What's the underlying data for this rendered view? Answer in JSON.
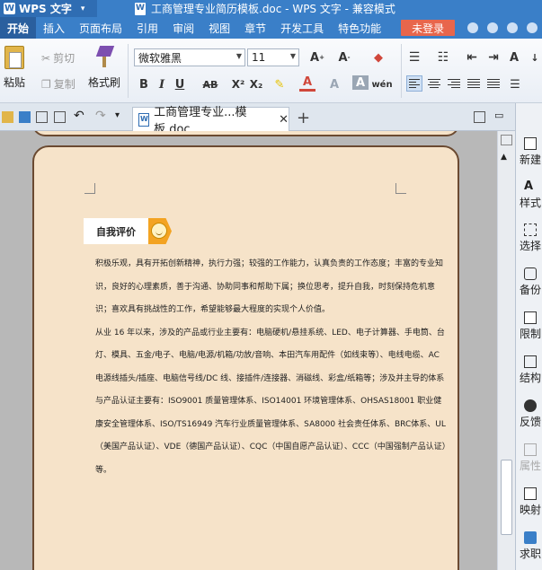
{
  "titlebar": {
    "app_name": "WPS 文字",
    "doc_title": "工商管理专业简历模板.doc - WPS 文字 - 兼容模式"
  },
  "menubar": {
    "items": [
      "开始",
      "插入",
      "页面布局",
      "引用",
      "审阅",
      "视图",
      "章节",
      "开发工具",
      "特色功能"
    ],
    "login_label": "未登录"
  },
  "ribbon": {
    "paste_label": "粘贴",
    "cut_label": "剪切",
    "copy_label": "复制",
    "format_painter_label": "格式刷",
    "font_name": "微软雅黑",
    "font_size": "11"
  },
  "tabbar": {
    "tab_label": "工商管理专业...模板.doc"
  },
  "document": {
    "section_title": "自我评价",
    "paragraphs": [
      "积极乐观，具有开拓创新精神，执行力强；较强的工作能力，认真负责的工作态度；丰富的专业知识，良好的心理素质，善于沟通、协助同事和帮助下属；换位思考，提升自我，时刻保持危机意识；喜欢具有挑战性的工作，希望能够最大程度的实现个人价值。",
      "从业 16 年以来，涉及的产品或行业主要有：电脑硬机/悬挂系统、LED、电子计算器、手电筒、台灯、模具、五金/电子、电脑/电源/机箱/功放/音响、本田汽车用配件（如线束等）、电线电缆、AC 电源线插头/插座、电脑信号线/DC 线、接插件/连接器、消磁线、彩盒/纸箱等；涉及并主导的体系与产品认证主要有：ISO9001 质量管理体系、ISO14001 环境管理体系、OHSAS18001 职业健康安全管理体系、ISO/TS16949 汽车行业质量管理体系、SA8000 社会责任体系、BRC体系、UL（美国产品认证）、VDE（德国产品认证）、CQC（中国自愿产品认证）、CCC（中国强制产品认证）等。"
    ]
  },
  "taskpane": {
    "items": [
      "新建",
      "样式",
      "选择",
      "备份",
      "限制",
      "结构",
      "反馈",
      "属性",
      "映射",
      "求职"
    ]
  }
}
